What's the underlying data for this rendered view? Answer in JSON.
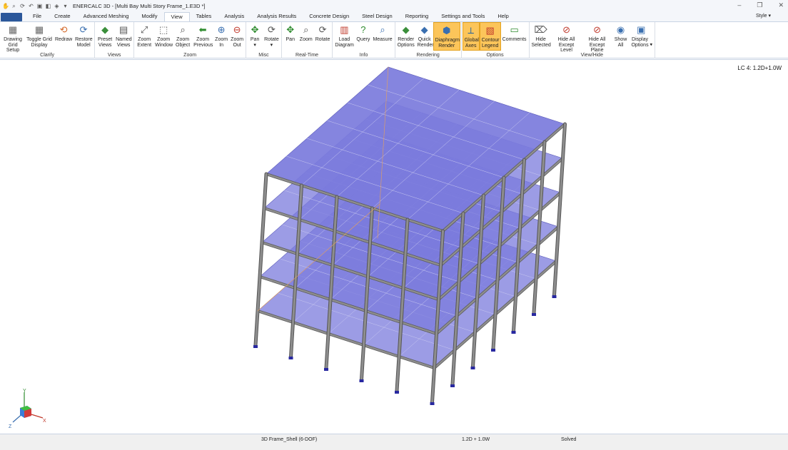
{
  "window": {
    "title": "ENERCALC 3D - [Multi Bay Multi Story Frame_1.E3D *]",
    "controls": [
      "–",
      "❐",
      "✕"
    ]
  },
  "menu": {
    "tabs": [
      "File",
      "Create",
      "Advanced Meshing",
      "Modify",
      "View",
      "Tables",
      "Analysis",
      "Analysis Results",
      "Concrete Design",
      "Steel Design",
      "Reporting",
      "Settings and Tools",
      "Help"
    ],
    "active": "View",
    "style_label": "Style"
  },
  "ribbon": {
    "clarify": {
      "label": "Clarify",
      "drawing_grid_setup": "Drawing Grid Setup",
      "toggle_grid_display": "Toggle Grid Display",
      "redraw": "Redraw",
      "restore_model": "Restore Model"
    },
    "views": {
      "label": "Views",
      "preset_views": "Preset Views",
      "named_views": "Named Views"
    },
    "zoom": {
      "label": "Zoom",
      "zoom_extent": "Zoom Extent",
      "zoom_window": "Zoom Window",
      "zoom_object": "Zoom Object",
      "zoom_previous": "Zoom Previous",
      "zoom_in": "Zoom In",
      "zoom_out": "Zoom Out"
    },
    "misc": {
      "label": "Misc",
      "pan": "Pan",
      "rotate": "Rotate"
    },
    "realtime": {
      "label": "Real-Time",
      "pan": "Pan",
      "zoom": "Zoom",
      "rotate": "Rotate"
    },
    "info": {
      "label": "Info",
      "load_diagram": "Load Diagram",
      "query": "Query",
      "measure": "Measure"
    },
    "rendering": {
      "label": "Rendering",
      "render_options": "Render Options",
      "quick_render": "Quick Render",
      "diaphragm_render": "Diaphragm Render"
    },
    "options": {
      "label": "Options",
      "global_axes": "Global Axes",
      "contour_legend": "Contour Legend",
      "comments": "Comments"
    },
    "viewhide": {
      "label": "View/Hide",
      "hide_selected": "Hide Selected",
      "hide_all_except_level": "Hide All Except Level",
      "hide_all_except_plane": "Hide All Except Plane",
      "show_all": "Show All",
      "display_options": "Display Options"
    }
  },
  "viewport": {
    "load_combo": "LC 4: 1.2D+1.0W",
    "axis_labels": {
      "y": "Y",
      "x": "X",
      "z": "Z"
    },
    "colors": {
      "slab": "#7b7bdc",
      "member": "#8e8e8e",
      "support": "#2828a0"
    }
  },
  "status": {
    "model_type": "3D Frame_Shell (6-DOF)",
    "load_combo": "1.2D + 1.0W",
    "state": "Solved"
  }
}
